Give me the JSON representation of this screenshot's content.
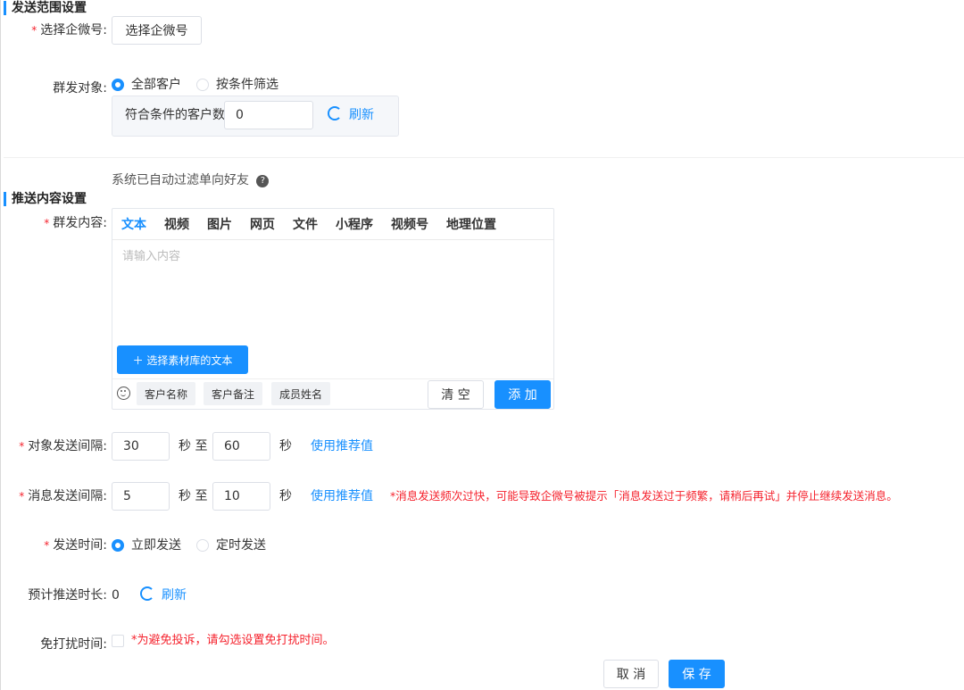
{
  "range_section": {
    "title": "发送范围设置",
    "account_label": "选择企微号:",
    "account_button": "选择企微号",
    "target_label": "群发对象:",
    "options": [
      "全部客户",
      "按条件筛选"
    ],
    "count_label": "符合条件的客户数",
    "count_value": "0",
    "refresh": "刷新"
  },
  "filter_note": "系统已自动过滤单向好友",
  "content_section": {
    "title": "推送内容设置",
    "content_label": "群发内容:",
    "tabs": [
      "文本",
      "视频",
      "图片",
      "网页",
      "文件",
      "小程序",
      "视频号",
      "地理位置"
    ],
    "placeholder": "请输入内容",
    "library_button": "＋ 选择素材库的文本",
    "tags": [
      "客户名称",
      "客户备注",
      "成员姓名"
    ],
    "clear_button": "清 空",
    "add_button": "添 加"
  },
  "target_interval": {
    "label": "对象发送间隔:",
    "from": "30",
    "to": "60",
    "sec_to": "秒 至",
    "sec": "秒",
    "recommend": "使用推荐值"
  },
  "message_interval": {
    "label": "消息发送间隔:",
    "from": "5",
    "to": "10",
    "sec_to": "秒 至",
    "sec": "秒",
    "recommend": "使用推荐值",
    "warning": "*消息发送频次过快，可能导致企微号被提示「消息发送过于频繁，请稍后再试」并停止继续发送消息。"
  },
  "send_time": {
    "label": "发送时间:",
    "options": [
      "立即发送",
      "定时发送"
    ]
  },
  "estimate": {
    "label": "预计推送时长:",
    "value": "0",
    "refresh": "刷新"
  },
  "dnd": {
    "label": "免打扰时间:",
    "warning": "*为避免投诉，请勾选设置免打扰时间。"
  },
  "footer": {
    "cancel": "取 消",
    "save": "保 存"
  },
  "colors": {
    "primary": "#1890ff",
    "danger": "#f5222d"
  }
}
